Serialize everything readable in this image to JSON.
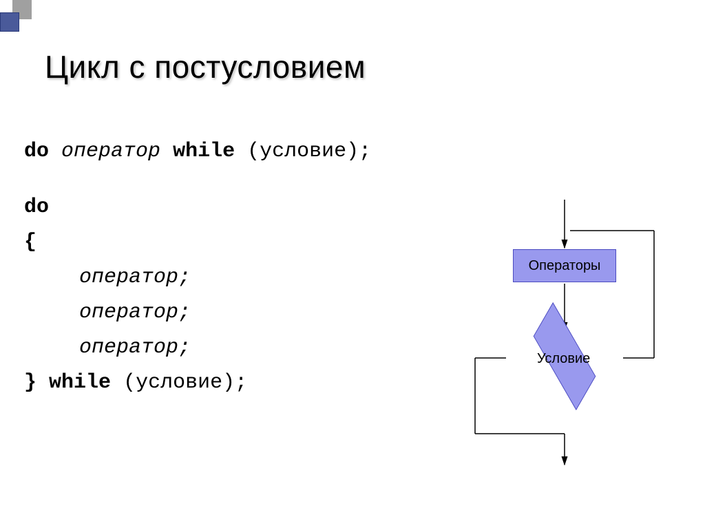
{
  "title": "Цикл с постусловием",
  "code": {
    "line1_do": "do",
    "line1_op": "оператор",
    "line1_while": "while",
    "line1_cond": "(условие);",
    "line2_do": "do",
    "line3_brace": "{",
    "line4_op": "оператор;",
    "line5_op": "оператор;",
    "line6_op": "оператор;",
    "line7_close": "}",
    "line7_while": "while",
    "line7_cond": "(условие);"
  },
  "diagram": {
    "box_label": "Операторы",
    "diamond_label": "Условие"
  },
  "colors": {
    "shape_fill": "#9999ee",
    "shape_stroke": "#4a4ac0",
    "accent_gray": "#a0a0a0",
    "accent_blue": "#4a5a9a"
  }
}
